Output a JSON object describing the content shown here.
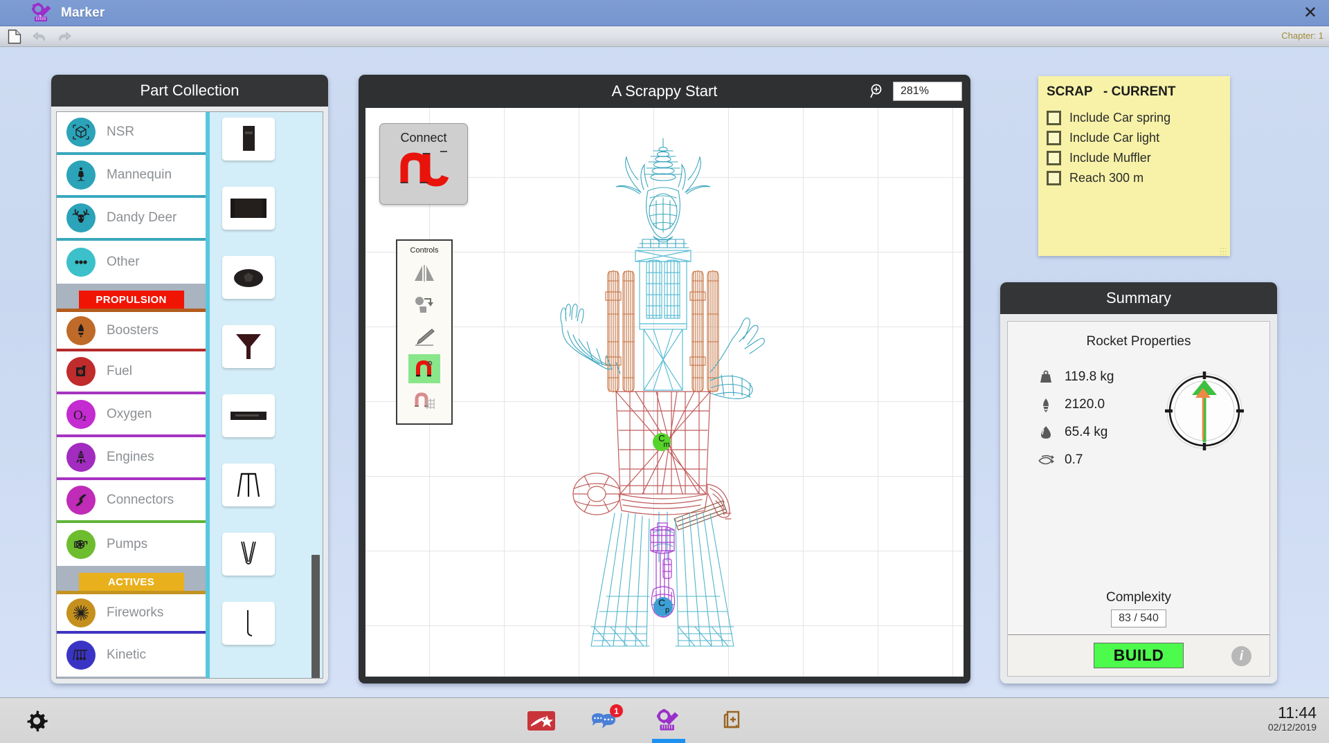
{
  "window": {
    "app_title": "Marker",
    "logo_icon": "gear-marker-logo",
    "close_icon": "close-icon"
  },
  "toolbar": {
    "new_icon": "new-document-icon",
    "undo_icon": "undo-arrow-icon",
    "redo_icon": "redo-arrow-icon",
    "chapter_label": "Chapter: 1"
  },
  "part_collection": {
    "title": "Part Collection",
    "categories": [
      {
        "label": "NSR",
        "icon": "nsr-cube-icon",
        "color": "#2ba3b8",
        "sep": "sep-blue-teal"
      },
      {
        "label": "Mannequin",
        "icon": "mannequin-icon",
        "color": "#2ba3b8",
        "sep": "sep-blue-teal"
      },
      {
        "label": "Dandy Deer",
        "icon": "deer-head-icon",
        "color": "#2ba3b8",
        "sep": "sep-blue-teal"
      },
      {
        "label": "Other",
        "icon": "ellipsis-icon",
        "color": "#3cc0c9",
        "sep": "sep-none"
      }
    ],
    "banner_propulsion": "PROPULSION",
    "propulsion": [
      {
        "label": "Boosters",
        "icon": "booster-rocket-icon",
        "color": "#bf6a28",
        "sep": "sep-red"
      },
      {
        "label": "Fuel",
        "icon": "fuel-can-icon",
        "color": "#c02b2b",
        "sep": "sep-purple"
      },
      {
        "label": "Oxygen",
        "icon": "oxygen-o2-icon",
        "color": "#c42bd1",
        "sep": "sep-purple"
      },
      {
        "label": "Engines",
        "icon": "engine-icon",
        "color": "#a22bc0",
        "sep": "sep-purple"
      },
      {
        "label": "Connectors",
        "icon": "connector-icon",
        "color": "#c02bb8",
        "sep": "sep-green"
      },
      {
        "label": "Pumps",
        "icon": "pump-turbine-icon",
        "color": "#6dbd2e",
        "sep": "sep-none"
      }
    ],
    "banner_actives": "ACTIVES",
    "actives": [
      {
        "label": "Fireworks",
        "icon": "firework-burst-icon",
        "color": "#c6901e",
        "sep": "sep-blue"
      },
      {
        "label": "Kinetic",
        "icon": "pendulum-icon",
        "color": "#3a34c4",
        "sep": "sep-none"
      }
    ],
    "thumbnails": [
      {
        "name": "part-thumb-battery",
        "icon": "dark-rectangle-part"
      },
      {
        "name": "part-thumb-drum",
        "icon": "dark-barrel-part"
      },
      {
        "name": "part-thumb-ball",
        "icon": "dark-sphere-part"
      },
      {
        "name": "part-thumb-funnel",
        "icon": "funnel-part"
      },
      {
        "name": "part-thumb-bar",
        "icon": "flat-bar-part"
      },
      {
        "name": "part-thumb-frame",
        "icon": "swing-frame-part"
      },
      {
        "name": "part-thumb-vcable",
        "icon": "v-cable-part"
      },
      {
        "name": "part-thumb-rod",
        "icon": "hook-rod-part"
      }
    ]
  },
  "canvas": {
    "title": "A Scrappy Start",
    "zoom_icon": "zoom-in-magnifier-icon",
    "zoom_value": "281%",
    "connect_label": "Connect",
    "connect_icon": "magnet-connect-icon",
    "controls_title": "Controls",
    "control_buttons": [
      {
        "name": "mirror-tool",
        "icon": "mirror-icon",
        "active": false
      },
      {
        "name": "move-copy-tool",
        "icon": "move-copy-icon",
        "active": false
      },
      {
        "name": "pen-tool",
        "icon": "pen-icon",
        "active": false
      },
      {
        "name": "magnet-snap-tool",
        "icon": "magnet-icon",
        "active": true
      },
      {
        "name": "magnet-grid-tool",
        "icon": "magnet-grid-icon",
        "active": false
      }
    ],
    "markers": {
      "center_of_mass": "Cm",
      "center_of_pressure": "Cp"
    }
  },
  "scrap": {
    "title": "SCRAP   - CURRENT",
    "objectives": [
      {
        "label": "Include Car spring",
        "checked": false
      },
      {
        "label": "Include Car light",
        "checked": false
      },
      {
        "label": "Include Muffler",
        "checked": false
      },
      {
        "label": "Reach 300 m",
        "checked": false
      }
    ]
  },
  "summary": {
    "title": "Summary",
    "subtitle": "Rocket Properties",
    "properties": [
      {
        "icon": "weight-icon",
        "value": "119.8 kg"
      },
      {
        "icon": "thrust-icon",
        "value": "2120.0"
      },
      {
        "icon": "fuel-drop-icon",
        "value": "65.4 kg"
      },
      {
        "icon": "drag-icon",
        "value": "0.7"
      }
    ],
    "gauge": {
      "name": "stability-gauge",
      "green_arrow": "up",
      "orange_arrow": "up"
    },
    "complexity_label": "Complexity",
    "complexity_value": "83 / 540",
    "build_label": "BUILD",
    "info_label": "i"
  },
  "taskbar": {
    "settings_icon": "gear-icon",
    "tray": [
      {
        "name": "tray-item-game",
        "icon": "red-star-shoe-icon",
        "badge": null,
        "active": false
      },
      {
        "name": "tray-item-chat",
        "icon": "chat-bubbles-icon",
        "badge": "1",
        "active": false
      },
      {
        "name": "tray-item-marker",
        "icon": "gear-marker-icon",
        "badge": null,
        "active": true
      },
      {
        "name": "tray-item-library",
        "icon": "add-to-library-icon",
        "badge": null,
        "active": false
      }
    ],
    "time": "11:44",
    "date": "02/12/2019"
  },
  "colors": {
    "titlebar": "#7a99d1",
    "panel_header": "#333537",
    "accent_teal": "#2ba3b8",
    "scrap_yellow": "#f7f2a8",
    "build_green": "#4dfb4d",
    "badge_red": "#e81c2a"
  }
}
